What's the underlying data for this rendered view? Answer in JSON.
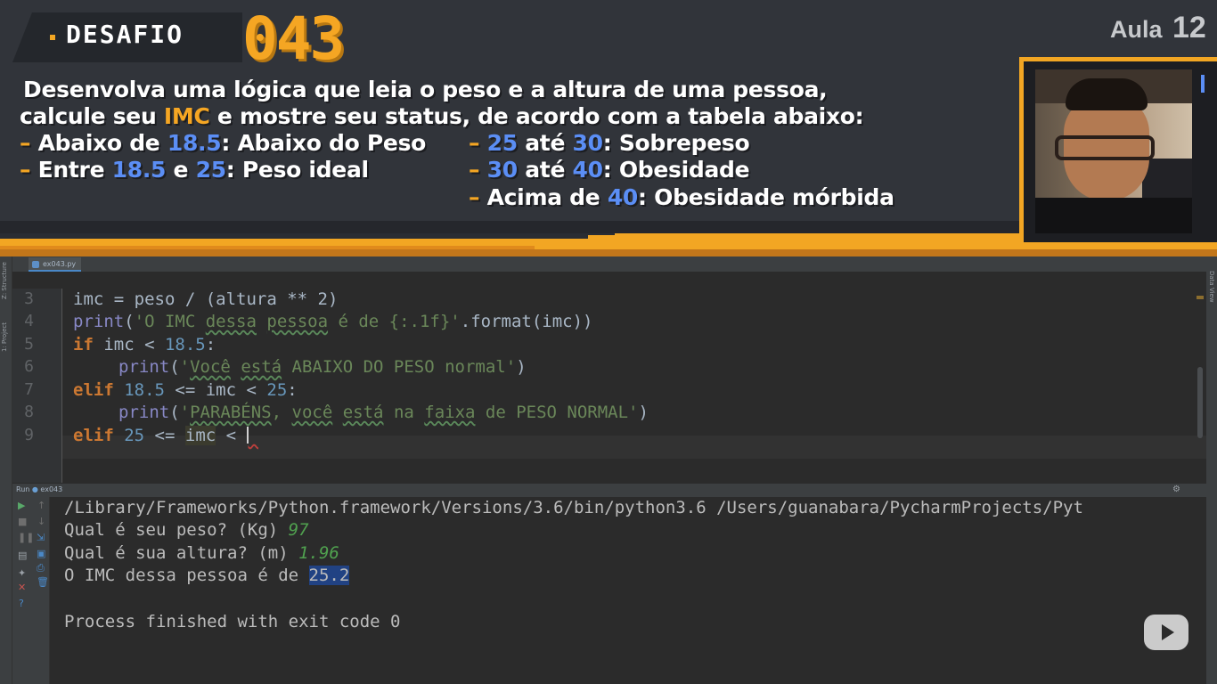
{
  "banner": {
    "title": "DESAFIO",
    "challenge_number": "043",
    "lesson_label": "Aula",
    "lesson_number": "12",
    "line1": "Desenvolva uma lógica que leia o peso e a altura de uma pessoa,",
    "line2_a": "calcule seu",
    "line2_imc": "IMC",
    "line2_b": "e mostre seu status, de acordo com a tabela abaixo:",
    "dash": "–",
    "items": [
      {
        "prefix": "Abaixo de",
        "v1": "18.5",
        "mid": "",
        "v2": "",
        "label": ": Abaixo do Peso"
      },
      {
        "prefix": "Entre",
        "v1": "18.5",
        "mid": "e",
        "v2": "25",
        "label": ": Peso ideal"
      },
      {
        "prefix": "",
        "v1": "25",
        "mid": "até",
        "v2": "30",
        "label": ": Sobrepeso"
      },
      {
        "prefix": "",
        "v1": "30",
        "mid": "até",
        "v2": "40",
        "label": ": Obesidade"
      },
      {
        "prefix": "Acima de",
        "v1": "40",
        "mid": "",
        "v2": "",
        "label": ": Obesidade mórbida"
      }
    ],
    "accent_orange": "#f5a623",
    "accent_blue": "#5b8ef5"
  },
  "ide": {
    "file_tab": "ex043.py",
    "left_tool_labels": [
      "Z: Structure",
      "1: Project"
    ],
    "right_tool_label": "Data View",
    "run_label": "Run",
    "run_config": "ex043",
    "toolbar_icons": [
      "run-icon",
      "stop-icon",
      "pause-icon",
      "layout-icon",
      "pin-icon",
      "close-icon",
      "help-icon",
      "up-arrow-icon",
      "down-arrow-icon",
      "wrap-icon",
      "export-icon",
      "print-icon",
      "trash-icon"
    ],
    "gear_icon": "⚙",
    "line_numbers": [
      "3",
      "4",
      "5",
      "6",
      "7",
      "8",
      "9"
    ],
    "code": {
      "l3": "imc = peso / (altura ** 2)",
      "l4_fn": "print",
      "l4_open": "(",
      "l4_s1": "'O IMC ",
      "l4_w1": "dessa",
      "l4_s2": " ",
      "l4_w2": "pessoa",
      "l4_s3": " é de {:.1f}'",
      "l4_rest": ".format(imc))",
      "l5_kw": "if",
      "l5_a": " imc < ",
      "l5_n": "18.5",
      "l5_b": ":",
      "l6_fn": "print",
      "l6_open": "(",
      "l6_s1": "'",
      "l6_w1": "Você",
      "l6_s2": " ",
      "l6_w2": "está",
      "l6_s3": " ABAIXO DO PESO normal'",
      "l6_close": ")",
      "l7_kw": "elif",
      "l7_n1": "18.5",
      "l7_a": " <= imc < ",
      "l7_n2": "25",
      "l7_b": ":",
      "l8_fn": "print",
      "l8_open": "(",
      "l8_s1": "'",
      "l8_w1": "PARABÉNS",
      "l8_s2": ", ",
      "l8_w2": "você",
      "l8_s3": " ",
      "l8_w3": "está",
      "l8_s4": " na ",
      "l8_w4": "faixa",
      "l8_s5": " de PESO NORMAL'",
      "l8_close": ")",
      "l9_kw": "elif",
      "l9_n": "25",
      "l9_a": " <= ",
      "l9_id": "imc",
      "l9_b": " <"
    },
    "console": {
      "cmd": "/Library/Frameworks/Python.framework/Versions/3.6/bin/python3.6 /Users/guanabara/PycharmProjects/Pyt",
      "q1": "Qual é seu peso? (Kg) ",
      "a1": "97",
      "q2": "Qual é sua altura? (m) ",
      "a2": "1.96",
      "r_label": "O IMC dessa pessoa é de ",
      "r_value": "25.2",
      "exit": "Process finished with exit code 0"
    }
  }
}
